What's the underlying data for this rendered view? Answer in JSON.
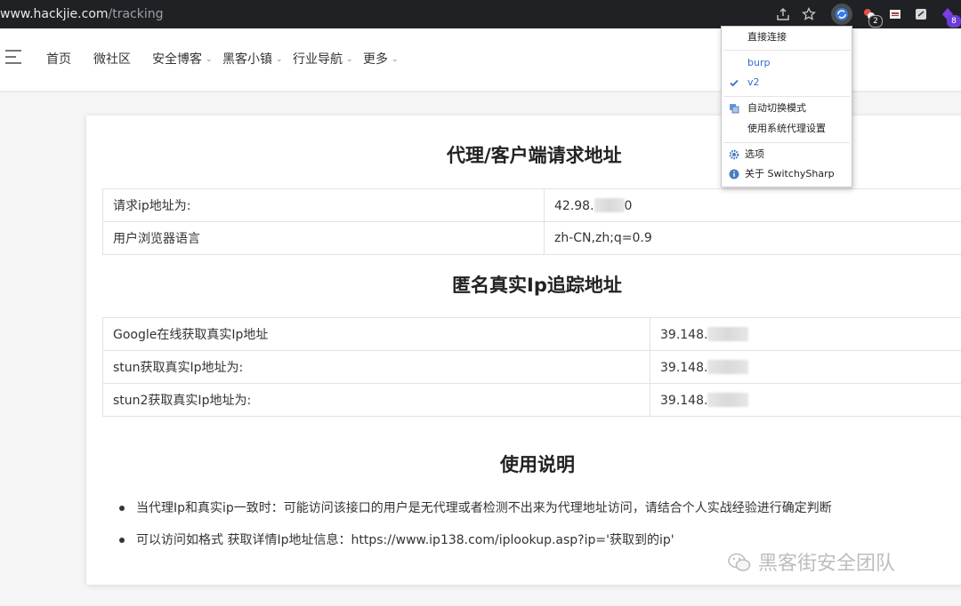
{
  "browser": {
    "url_host": "www.hackjie.com",
    "url_path": "/tracking",
    "extension_badges": [
      "2",
      "8"
    ]
  },
  "nav": {
    "items": [
      {
        "label": "首页",
        "dropdown": false
      },
      {
        "label": "微社区",
        "dropdown": false
      },
      {
        "label": "安全博客",
        "dropdown": true
      },
      {
        "label": "黑客小镇",
        "dropdown": true
      },
      {
        "label": "行业导航",
        "dropdown": true
      },
      {
        "label": "更多",
        "dropdown": true
      }
    ]
  },
  "section1": {
    "title": "代理/客户端请求地址",
    "rows": [
      {
        "label": "请求ip地址为:",
        "value": "42.98.",
        "value_tail": "0"
      },
      {
        "label": "用户浏览器语言",
        "value": "zh-CN,zh;q=0.9",
        "value_tail": ""
      }
    ]
  },
  "section2": {
    "title": "匿名真实Ip追踪地址",
    "rows": [
      {
        "label": "Google在线获取真实Ip地址",
        "value": "39.148."
      },
      {
        "label": "stun获取真实Ip地址为:",
        "value": "39.148."
      },
      {
        "label": "stun2获取真实Ip地址为:",
        "value": "39.148."
      }
    ]
  },
  "section3": {
    "title": "使用说明",
    "bullets": [
      "当代理Ip和真实ip一致时：可能访问该接口的用户是无代理或者检测不出来为代理地址访问，请结合个人实战经验进行确定判断",
      "可以访问如格式 获取详情Ip地址信息：https://www.ip138.com/iplookup.asp?ip='获取到的ip'"
    ]
  },
  "proxy_menu": {
    "direct": "直接连接",
    "profiles": [
      {
        "label": "burp",
        "checked": false
      },
      {
        "label": "v2",
        "checked": true
      }
    ],
    "auto_switch": "自动切换模式",
    "system_proxy": "使用系统代理设置",
    "options": "选项",
    "about": "关于 SwitchySharp"
  },
  "watermark": "黑客街安全团队",
  "colors": {
    "menu_active": "#2f6fcf",
    "topbar": "#202124",
    "extension_badge": "#6a3cd8"
  },
  "icons": [
    "share-icon",
    "star-icon",
    "switchysharp-icon",
    "extension-icon",
    "gear-icon",
    "info-icon",
    "checkmark-icon",
    "wechat-icon",
    "hamburger-menu-icon"
  ]
}
